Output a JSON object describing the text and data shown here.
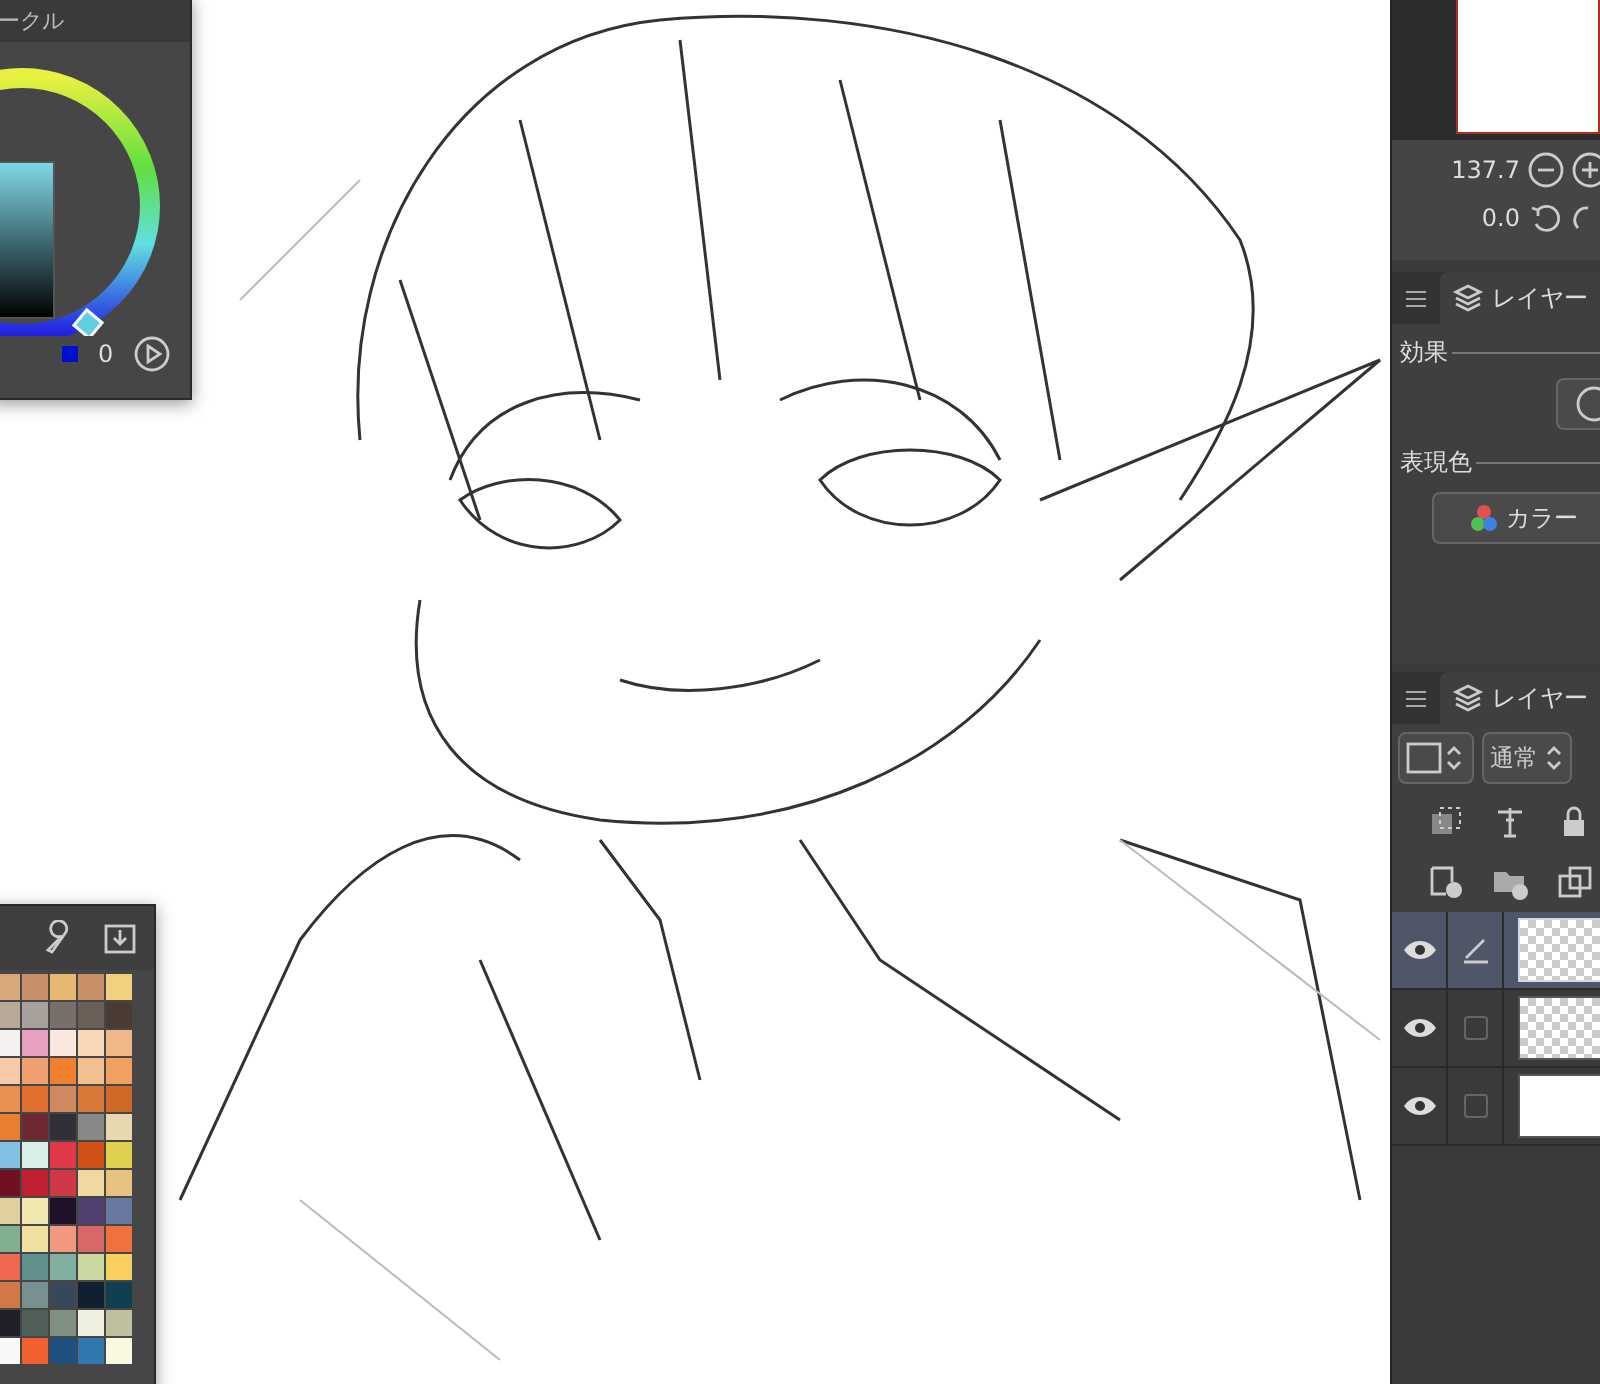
{
  "color_circle": {
    "title": "ークル",
    "values": [
      "0"
    ]
  },
  "palette": {
    "swatches": [
      {
        "color": "#d9a87a"
      },
      {
        "color": "#c8906a"
      },
      {
        "color": "#e8b870"
      },
      {
        "color": "#c89068"
      },
      {
        "color": "#f2d080"
      },
      {
        "color": "#b8a898"
      },
      {
        "color": "#a8a09a"
      },
      {
        "color": "#787068"
      },
      {
        "color": "#6a6058"
      },
      {
        "color": "#4a3c34"
      },
      {
        "color": "#f4f0f0"
      },
      {
        "color": "#e8a0c0"
      },
      {
        "color": "#f8e8e0"
      },
      {
        "color": "#f8d8b8"
      },
      {
        "color": "#f0b888"
      },
      {
        "color": "#f8c8a8"
      },
      {
        "color": "#f0a070"
      },
      {
        "color": "#f08030"
      },
      {
        "color": "#f0c090"
      },
      {
        "color": "#f0a060"
      },
      {
        "color": "#e89050"
      },
      {
        "color": "#e07030"
      },
      {
        "color": "#d08860"
      },
      {
        "color": "#d87838"
      },
      {
        "color": "#d06828"
      },
      {
        "color": "#e88030"
      },
      {
        "color": "#702830"
      },
      {
        "color": "#303038"
      },
      {
        "color": "#888888"
      },
      {
        "color": "#e8d8b0"
      },
      {
        "color": "#80c0e0"
      },
      {
        "color": "#d8f0e8"
      },
      {
        "color": "#e03848"
      },
      {
        "color": "#d05018"
      },
      {
        "color": "#e0d050"
      },
      {
        "color": "#701020"
      },
      {
        "color": "#c02030"
      },
      {
        "color": "#d03848"
      },
      {
        "color": "#f0d8a0"
      },
      {
        "color": "#e8c080"
      },
      {
        "color": "#e0d0a0"
      },
      {
        "color": "#f0e8b0"
      },
      {
        "color": "#201028"
      },
      {
        "color": "#504070"
      },
      {
        "color": "#6878a0"
      },
      {
        "color": "#80b090"
      },
      {
        "color": "#f0e0a0"
      },
      {
        "color": "#f09880"
      },
      {
        "color": "#d86868"
      },
      {
        "color": "#f07040"
      },
      {
        "color": "#f06850"
      },
      {
        "color": "#60908c"
      },
      {
        "color": "#80b0a0"
      },
      {
        "color": "#c8d8a0"
      },
      {
        "color": "#f8d060"
      },
      {
        "color": "#d07848"
      },
      {
        "color": "#789090"
      },
      {
        "color": "#384858"
      },
      {
        "color": "#102030"
      },
      {
        "color": "#104050"
      },
      {
        "color": "#202028"
      },
      {
        "color": "#506058"
      },
      {
        "color": "#809080"
      },
      {
        "color": "#f0f0e0"
      },
      {
        "color": "#c0c0a0"
      },
      {
        "color": "#f8f8f8"
      },
      {
        "color": "#f06030"
      },
      {
        "color": "#205080"
      },
      {
        "color": "#3078b0"
      },
      {
        "color": "#f8f8e0"
      }
    ]
  },
  "navigator": {
    "zoom": "137.7",
    "rotation": "0.0"
  },
  "property_panel": {
    "tab": "レイヤー",
    "effect_label": "効果",
    "expression_label": "表現色",
    "expression_button": "カラー"
  },
  "layer_panel": {
    "tab": "レイヤー",
    "blend_mode": "通常",
    "layers": [
      {
        "kind": "pen",
        "selected": true,
        "transparent": true
      },
      {
        "kind": "checkbox",
        "selected": false,
        "checked": false,
        "transparent": true
      },
      {
        "kind": "checkbox",
        "selected": false,
        "checked": false,
        "transparent": false
      }
    ]
  }
}
